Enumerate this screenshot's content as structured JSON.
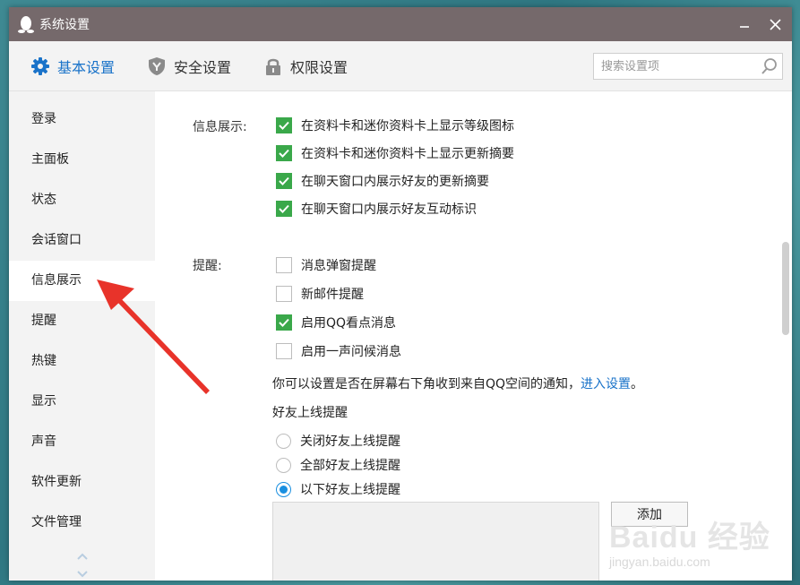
{
  "window": {
    "title": "系统设置"
  },
  "tabs": [
    {
      "label": "基本设置",
      "icon": "gear-icon",
      "active": true
    },
    {
      "label": "安全设置",
      "icon": "shield-icon",
      "active": false
    },
    {
      "label": "权限设置",
      "icon": "lock-icon",
      "active": false
    }
  ],
  "search": {
    "placeholder": "搜索设置项"
  },
  "sidebar": {
    "items": [
      {
        "label": "登录"
      },
      {
        "label": "主面板"
      },
      {
        "label": "状态"
      },
      {
        "label": "会话窗口"
      },
      {
        "label": "信息展示",
        "active": true
      },
      {
        "label": "提醒"
      },
      {
        "label": "热键"
      },
      {
        "label": "显示"
      },
      {
        "label": "声音"
      },
      {
        "label": "软件更新"
      },
      {
        "label": "文件管理"
      }
    ]
  },
  "info_display": {
    "label": "信息展示:",
    "options": [
      {
        "label": "在资料卡和迷你资料卡上显示等级图标",
        "checked": true
      },
      {
        "label": "在资料卡和迷你资料卡上显示更新摘要",
        "checked": true
      },
      {
        "label": "在聊天窗口内展示好友的更新摘要",
        "checked": true
      },
      {
        "label": "在聊天窗口内展示好友互动标识",
        "checked": true
      }
    ]
  },
  "reminder": {
    "label": "提醒:",
    "options": [
      {
        "label": "消息弹窗提醒",
        "checked": false
      },
      {
        "label": "新邮件提醒",
        "checked": false
      },
      {
        "label": "启用QQ看点消息",
        "checked": true
      },
      {
        "label": "启用一声问候消息",
        "checked": false
      }
    ],
    "notice_text": "你可以设置是否在屏幕右下角收到来自QQ空间的通知，",
    "notice_link": "进入设置",
    "notice_end": "。",
    "friend_online_heading": "好友上线提醒",
    "friend_online_options": [
      {
        "label": "关闭好友上线提醒",
        "selected": false
      },
      {
        "label": "全部好友上线提醒",
        "selected": false
      },
      {
        "label": "以下好友上线提醒",
        "selected": true
      }
    ],
    "add_button": "添加"
  },
  "watermark": {
    "brand": "Baidu 经验",
    "url": "jingyan.baidu.com"
  },
  "colors": {
    "accent": "#1a73c9",
    "check": "#3aa84a",
    "titlebar": "#75696b",
    "annotation_arrow": "#e8332a"
  }
}
